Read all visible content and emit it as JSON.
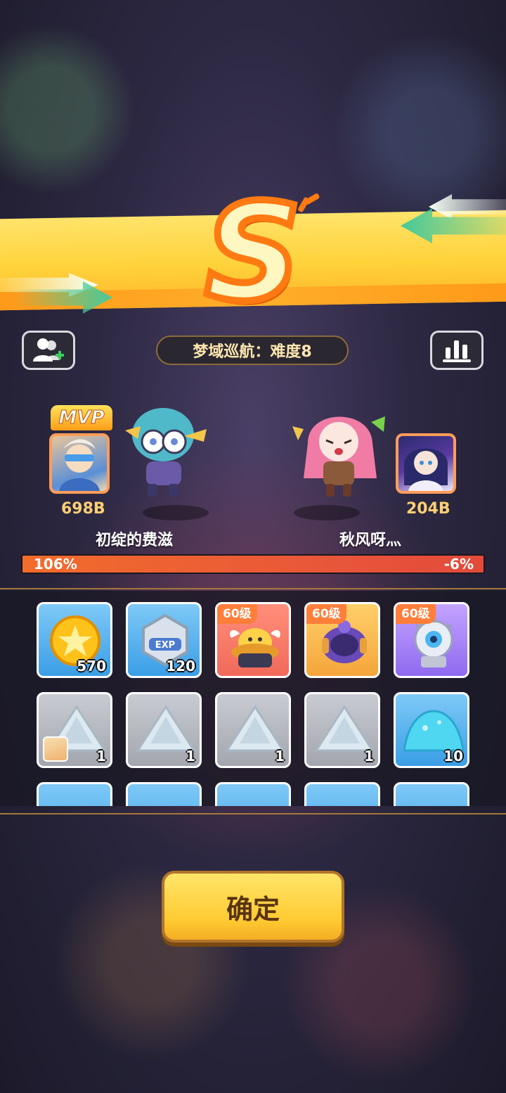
{
  "result": {
    "grade": "S"
  },
  "stage": {
    "title": "梦域巡航：难度8"
  },
  "players": [
    {
      "badge": "MVP",
      "score": "698B",
      "name": "初绽的费滋",
      "damage_pct": "106%"
    },
    {
      "score": "204B",
      "name": "秋风呀灬",
      "damage_pct": "-6%"
    }
  ],
  "icons": {
    "add_friend": "add-friend-icon",
    "stats": "bar-chart-icon"
  },
  "rewards": [
    {
      "kind": "gold-coin",
      "qty": "570",
      "level": "",
      "bg": "blue"
    },
    {
      "kind": "exp-badge",
      "qty": "120",
      "level": "",
      "bg": "blue"
    },
    {
      "kind": "pet-helmet",
      "qty": "",
      "level": "60级",
      "bg": "red"
    },
    {
      "kind": "purple-bracer",
      "qty": "",
      "level": "60级",
      "bg": "orange"
    },
    {
      "kind": "spiked-orb",
      "qty": "",
      "level": "60级",
      "bg": "purple"
    },
    {
      "kind": "silver-shard",
      "qty": "1",
      "level": "",
      "bg": "gray"
    },
    {
      "kind": "silver-shard",
      "qty": "1",
      "level": "",
      "bg": "gray"
    },
    {
      "kind": "silver-shard",
      "qty": "1",
      "level": "",
      "bg": "gray"
    },
    {
      "kind": "silver-shard",
      "qty": "1",
      "level": "",
      "bg": "gray"
    },
    {
      "kind": "blue-powder",
      "qty": "10",
      "level": "",
      "bg": "blue"
    }
  ],
  "confirm": {
    "label": "确定"
  },
  "colors": {
    "banner": "#ffd23a",
    "grade_stroke": "#ff7a12",
    "bar_left": "#f26c2c",
    "bar_right": "#e24a3a",
    "confirm": "#ffcb32"
  }
}
